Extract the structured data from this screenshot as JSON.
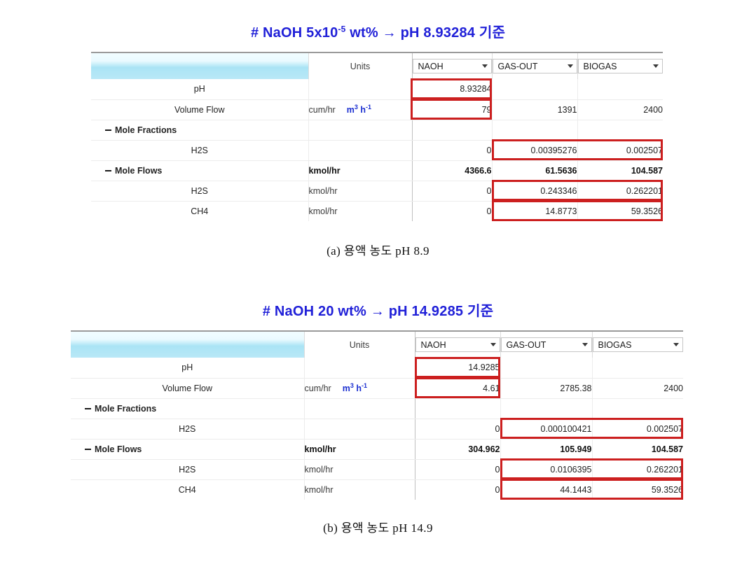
{
  "figures": [
    {
      "id": "a",
      "title_parts": {
        "pre": "# NaOH 5x10",
        "sup": "-5",
        "post": " wt% → pH 8.93284 기준"
      },
      "title_plain": "# NaOH 5x10-5 wt% → pH 8.93284 기준",
      "caption": "(a) 용액 농도 pH 8.9",
      "table": {
        "units_header": "Units",
        "streams": [
          {
            "name": "NAOH"
          },
          {
            "name": "GAS-OUT"
          },
          {
            "name": "BIOGAS"
          }
        ],
        "rows": [
          {
            "label": "pH",
            "group": false,
            "units_text": "",
            "units_si": "",
            "values": [
              "8.93284",
              "",
              ""
            ]
          },
          {
            "label": "Volume Flow",
            "group": false,
            "units_text": "cum/hr",
            "units_si": "m3 h-1",
            "values": [
              "79",
              "1391",
              "2400"
            ]
          },
          {
            "label": "Mole Fractions",
            "group": true,
            "units_text": "",
            "units_si": "",
            "values": [
              "",
              "",
              ""
            ]
          },
          {
            "label": "H2S",
            "group": false,
            "units_text": "",
            "units_si": "",
            "values": [
              "0",
              "0.00395276",
              "0.002507"
            ]
          },
          {
            "label": "Mole Flows",
            "group": true,
            "units_text": "kmol/hr",
            "units_si": "",
            "values": [
              "4366.6",
              "61.5636",
              "104.587"
            ]
          },
          {
            "label": "H2S",
            "group": false,
            "units_text": "kmol/hr",
            "units_si": "",
            "values": [
              "0",
              "0.243346",
              "0.262201"
            ]
          },
          {
            "label": "CH4",
            "group": false,
            "units_text": "kmol/hr",
            "units_si": "",
            "values": [
              "0",
              "14.8773",
              "59.3526"
            ]
          }
        ]
      }
    },
    {
      "id": "b",
      "title_parts": {
        "pre": "# NaOH 20 wt% → pH 14.9285 기준",
        "sup": "",
        "post": ""
      },
      "title_plain": "# NaOH 20 wt% → pH 14.9285 기준",
      "caption": "(b) 용액 농도 pH 14.9",
      "table": {
        "units_header": "Units",
        "streams": [
          {
            "name": "NAOH"
          },
          {
            "name": "GAS-OUT"
          },
          {
            "name": "BIOGAS"
          }
        ],
        "rows": [
          {
            "label": "pH",
            "group": false,
            "units_text": "",
            "units_si": "",
            "values": [
              "14.9285",
              "",
              ""
            ]
          },
          {
            "label": "Volume Flow",
            "group": false,
            "units_text": "cum/hr",
            "units_si": "m3 h-1",
            "values": [
              "4.61",
              "2785.38",
              "2400"
            ]
          },
          {
            "label": "Mole Fractions",
            "group": true,
            "units_text": "",
            "units_si": "",
            "values": [
              "",
              "",
              ""
            ]
          },
          {
            "label": "H2S",
            "group": false,
            "units_text": "",
            "units_si": "",
            "values": [
              "0",
              "0.000100421",
              "0.002507"
            ]
          },
          {
            "label": "Mole Flows",
            "group": true,
            "units_text": "kmol/hr",
            "units_si": "",
            "values": [
              "304.962",
              "105.949",
              "104.587"
            ]
          },
          {
            "label": "H2S",
            "group": false,
            "units_text": "kmol/hr",
            "units_si": "",
            "values": [
              "0",
              "0.0106395",
              "0.262201"
            ]
          },
          {
            "label": "CH4",
            "group": false,
            "units_text": "kmol/hr",
            "units_si": "",
            "values": [
              "0",
              "44.1443",
              "59.3526"
            ]
          }
        ]
      }
    }
  ],
  "colors": {
    "title_blue": "#2020d8",
    "unit_blue": "#1a2ed0",
    "highlight_red": "#cc1f1f",
    "header_band_blue": "#aae4f5"
  }
}
